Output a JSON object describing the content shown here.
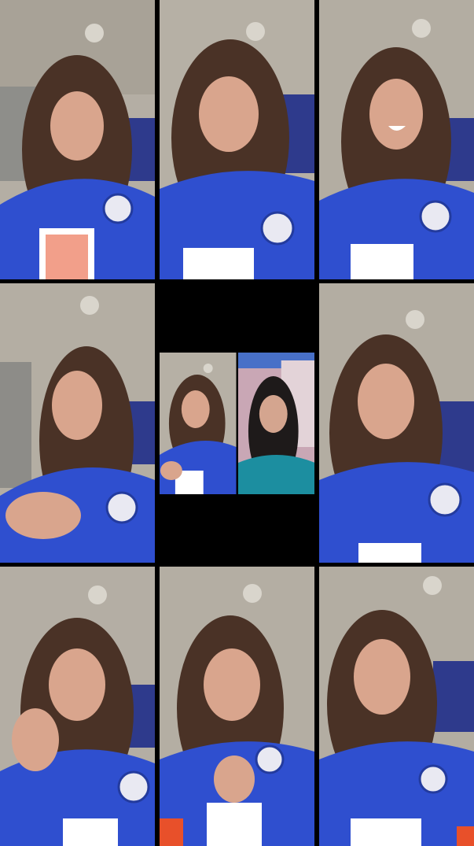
{
  "frames": [
    {
      "id": "1",
      "pose": "eyes-closed"
    },
    {
      "id": "2",
      "pose": "talking"
    },
    {
      "id": "3",
      "pose": "smiling"
    },
    {
      "id": "4",
      "pose": "looking-left-hand-wave"
    },
    {
      "id": "5",
      "pose": "split-duet"
    },
    {
      "id": "6",
      "pose": "pouting"
    },
    {
      "id": "7",
      "pose": "ok-hand-sign"
    },
    {
      "id": "8",
      "pose": "hand-on-chest"
    },
    {
      "id": "9",
      "pose": "talking"
    }
  ],
  "colors": {
    "wall": "#c8c3ba",
    "ceiling": "#b9b3a9",
    "jersey": "#2f4fcf",
    "jersey_dark": "#233b9e",
    "jersey_trim": "#e8502a",
    "hair": "#4a3226",
    "skin": "#d9a58d",
    "teal_top": "#1c8ea0",
    "pink_curtain": "#c9a7b5"
  }
}
